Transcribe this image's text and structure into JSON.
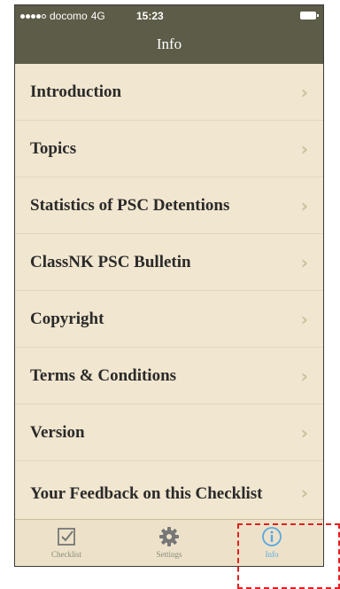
{
  "status_bar": {
    "carrier": "docomo",
    "network": "4G",
    "time": "15:23"
  },
  "nav": {
    "title": "Info"
  },
  "list": {
    "items": [
      {
        "label": "Introduction"
      },
      {
        "label": "Topics"
      },
      {
        "label": "Statistics of PSC Detentions"
      },
      {
        "label": "ClassNK PSC Bulletin"
      },
      {
        "label": "Copyright"
      },
      {
        "label": "Terms & Conditions"
      },
      {
        "label": "Version"
      },
      {
        "label": "Your Feedback on this Checklist"
      }
    ],
    "chevron": "›"
  },
  "tabs": [
    {
      "label": "Checklist",
      "icon": "checkbox-icon"
    },
    {
      "label": "Settings",
      "icon": "gear-icon"
    },
    {
      "label": "Info",
      "icon": "info-icon",
      "active": true
    }
  ],
  "colors": {
    "bar": "#5c5c48",
    "background": "#f1e6cf",
    "active_tab": "#5aa8e0",
    "highlight": "#e02020"
  }
}
